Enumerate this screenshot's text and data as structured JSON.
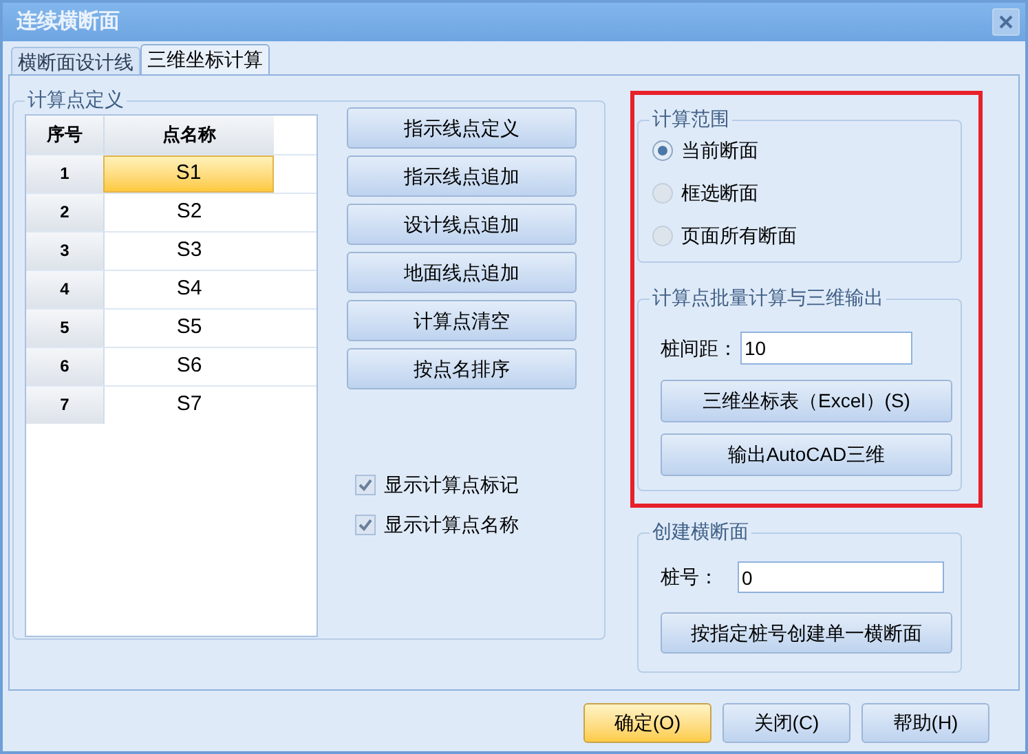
{
  "window": {
    "title": "连续横断面"
  },
  "tabs": [
    {
      "label": "横断面设计线",
      "selected": false
    },
    {
      "label": "三维坐标计算",
      "selected": true
    }
  ],
  "points_group": {
    "title": "计算点定义",
    "table": {
      "columns": [
        "序号",
        "点名称"
      ],
      "rows": [
        {
          "index": "1",
          "name": "S1",
          "selected": true
        },
        {
          "index": "2",
          "name": "S2",
          "selected": false
        },
        {
          "index": "3",
          "name": "S3",
          "selected": false
        },
        {
          "index": "4",
          "name": "S4",
          "selected": false
        },
        {
          "index": "5",
          "name": "S5",
          "selected": false
        },
        {
          "index": "6",
          "name": "S6",
          "selected": false
        },
        {
          "index": "7",
          "name": "S7",
          "selected": false
        }
      ]
    },
    "buttons": [
      "指示线点定义",
      "指示线点追加",
      "设计线点追加",
      "地面线点追加",
      "计算点清空",
      "按点名排序"
    ],
    "checkboxes": [
      {
        "label": "显示计算点标记",
        "checked": true
      },
      {
        "label": "显示计算点名称",
        "checked": true
      }
    ]
  },
  "range_group": {
    "title": "计算范围",
    "options": [
      {
        "label": "当前断面",
        "selected": true
      },
      {
        "label": "框选断面",
        "selected": false
      },
      {
        "label": "页面所有断面",
        "selected": false
      }
    ]
  },
  "batch_group": {
    "title": "计算点批量计算与三维输出",
    "field_label": "桩间距：",
    "field_value": "10",
    "buttons": [
      "三维坐标表（Excel）(S)",
      "输出AutoCAD三维"
    ]
  },
  "create_group": {
    "title": "创建横断面",
    "field_label": "桩号：",
    "field_value": "0",
    "button": "按指定桩号创建单一横断面"
  },
  "footer_buttons": [
    {
      "label": "确定(O)",
      "default": true
    },
    {
      "label": "关闭(C)",
      "default": false
    },
    {
      "label": "帮助(H)",
      "default": false
    }
  ]
}
